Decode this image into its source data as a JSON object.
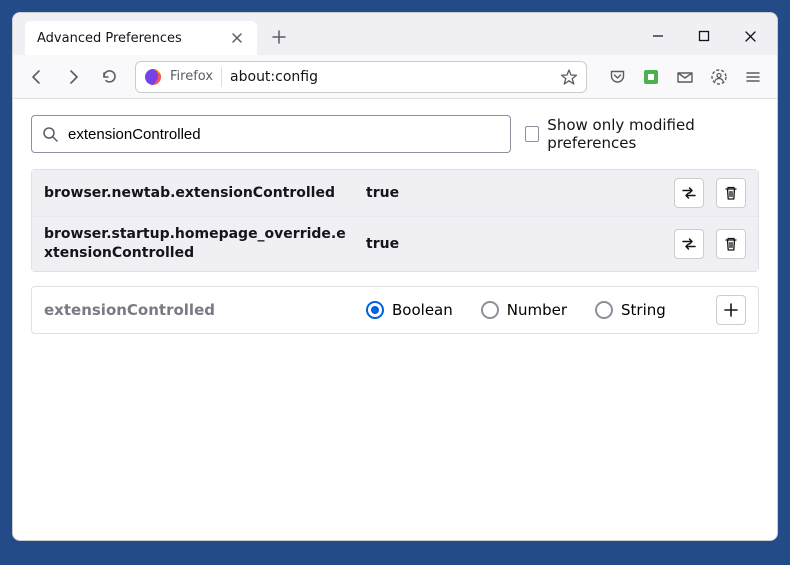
{
  "window": {
    "tab_title": "Advanced Preferences"
  },
  "toolbar": {
    "identity_label": "Firefox",
    "url": "about:config"
  },
  "search": {
    "value": "extensionControlled",
    "checkbox_label": "Show only modified preferences"
  },
  "prefs": [
    {
      "name": "browser.newtab.extensionControlled",
      "value": "true"
    },
    {
      "name": "browser.startup.homepage_override.extensionControlled",
      "value": "true"
    }
  ],
  "add_row": {
    "name": "extensionControlled",
    "types": [
      "Boolean",
      "Number",
      "String"
    ],
    "selected": 0
  }
}
